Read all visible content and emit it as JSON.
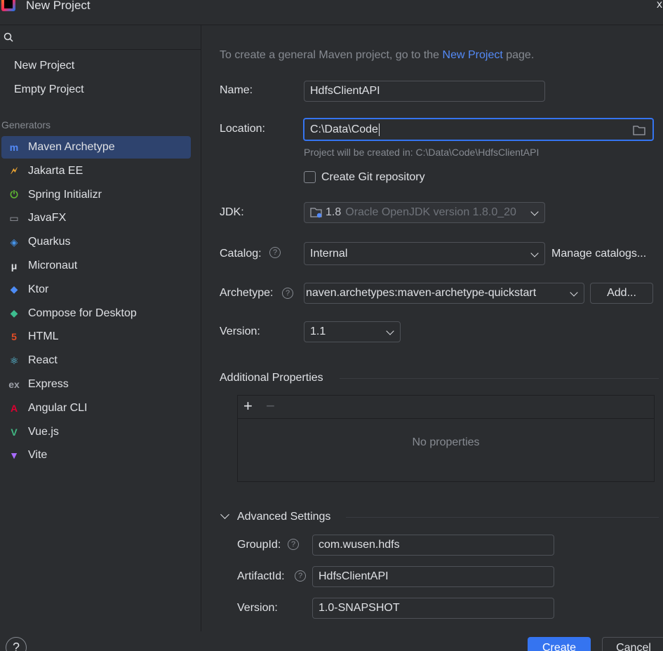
{
  "window": {
    "title": "New Project",
    "close_glyph": "x"
  },
  "sidebar": {
    "search_placeholder": "",
    "top_items": [
      {
        "label": "New Project"
      },
      {
        "label": "Empty Project"
      }
    ],
    "generators_header": "Generators",
    "generators": [
      {
        "label": "Maven Archetype",
        "icon": "maven-icon",
        "glyph": "m",
        "color": "#548af7",
        "selected": true
      },
      {
        "label": "Jakarta EE",
        "icon": "jakarta-icon",
        "glyph": "🗲",
        "color": "#f0a732"
      },
      {
        "label": "Spring Initializr",
        "icon": "spring-icon",
        "glyph": "⏻",
        "color": "#5fb832"
      },
      {
        "label": "JavaFX",
        "icon": "javafx-icon",
        "glyph": "▭",
        "color": "#9da0a8"
      },
      {
        "label": "Quarkus",
        "icon": "quarkus-icon",
        "glyph": "◈",
        "color": "#4695eb"
      },
      {
        "label": "Micronaut",
        "icon": "micronaut-icon",
        "glyph": "μ",
        "color": "#dfe1e5"
      },
      {
        "label": "Ktor",
        "icon": "ktor-icon",
        "glyph": "◆",
        "color": "#4d8cf5"
      },
      {
        "label": "Compose for Desktop",
        "icon": "compose-icon",
        "glyph": "◆",
        "color": "#3dbd8f"
      },
      {
        "label": "HTML",
        "icon": "html-icon",
        "glyph": "5",
        "color": "#e44d26"
      },
      {
        "label": "React",
        "icon": "react-icon",
        "glyph": "⚛",
        "color": "#61dafb"
      },
      {
        "label": "Express",
        "icon": "express-icon",
        "glyph": "ex",
        "color": "#9da0a8"
      },
      {
        "label": "Angular CLI",
        "icon": "angular-icon",
        "glyph": "A",
        "color": "#dd0031"
      },
      {
        "label": "Vue.js",
        "icon": "vue-icon",
        "glyph": "V",
        "color": "#41b883"
      },
      {
        "label": "Vite",
        "icon": "vite-icon",
        "glyph": "▼",
        "color": "#a86bff"
      }
    ]
  },
  "main": {
    "hint_prefix": "To create a general Maven project, go to the ",
    "hint_link": "New Project",
    "hint_suffix": " page.",
    "name": {
      "label": "Name:",
      "value": "HdfsClientAPI"
    },
    "location": {
      "label": "Location:",
      "value": "C:\\Data\\Code",
      "hint": "Project will be created in: C:\\Data\\Code\\HdfsClientAPI"
    },
    "git": {
      "label": "Create Git repository",
      "checked": false
    },
    "jdk": {
      "label": "JDK:",
      "version": "1.8",
      "detail": "Oracle OpenJDK version 1.8.0_20"
    },
    "catalog": {
      "label": "Catalog:",
      "value": "Internal",
      "manage_link": "Manage catalogs..."
    },
    "archetype": {
      "label": "Archetype:",
      "value": "naven.archetypes:maven-archetype-quickstart",
      "add_button": "Add..."
    },
    "version": {
      "label": "Version:",
      "value": "1.1"
    },
    "additional_properties": {
      "title": "Additional Properties",
      "empty_text": "No properties"
    },
    "advanced": {
      "title": "Advanced Settings",
      "group_id": {
        "label": "GroupId:",
        "value": "com.wusen.hdfs"
      },
      "artifact_id": {
        "label": "ArtifactId:",
        "value": "HdfsClientAPI"
      },
      "version": {
        "label": "Version:",
        "value": "1.0-SNAPSHOT"
      }
    }
  },
  "footer": {
    "help": "?",
    "create": "Create",
    "cancel": "Cancel"
  }
}
